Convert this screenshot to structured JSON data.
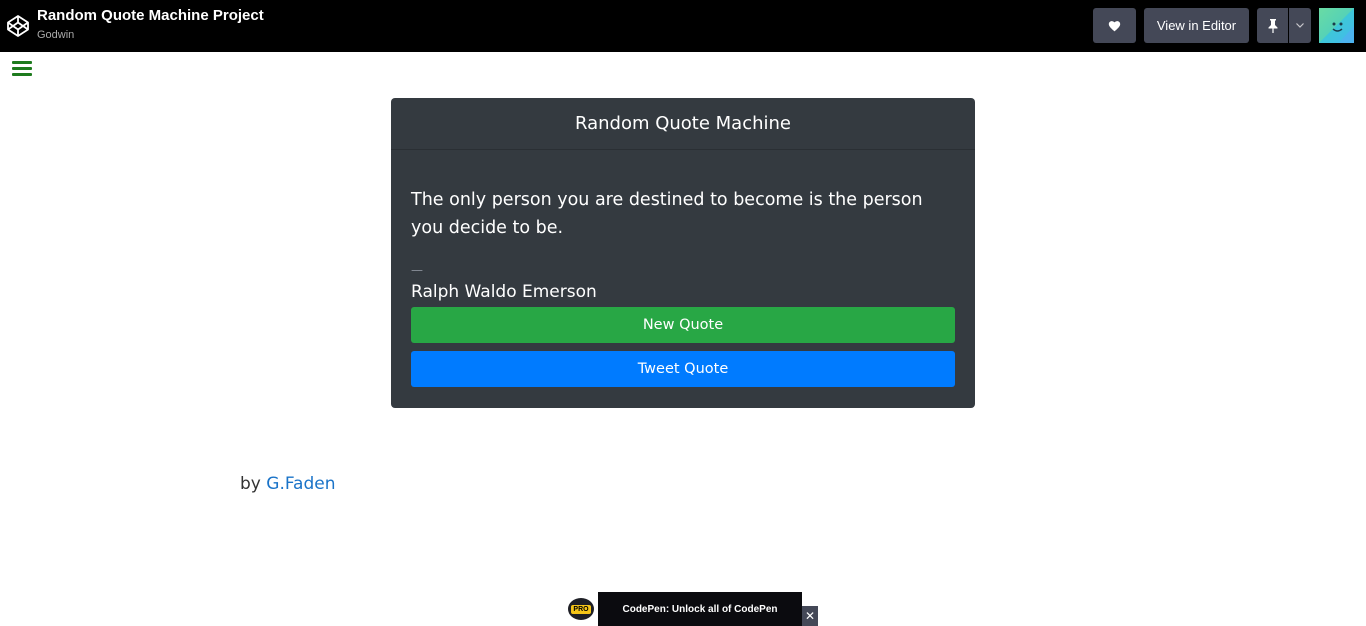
{
  "header": {
    "title": "Random Quote Machine Project",
    "author": "Godwin",
    "view_in_editor_label": "View in Editor"
  },
  "card": {
    "title": "Random Quote Machine",
    "quote": "The only person you are destined to become is the person you decide to be.",
    "dash": "—",
    "author": "Ralph Waldo Emerson",
    "new_quote_label": "New Quote",
    "tweet_quote_label": "Tweet Quote"
  },
  "byline": {
    "prefix": "by ",
    "link": "G.Faden"
  },
  "promo": {
    "badge": "PRO",
    "text": "CodePen: Unlock all of CodePen",
    "close": "✕"
  },
  "colors": {
    "new_quote": "#28a745",
    "tweet_quote": "#007bff",
    "card_bg": "#343a40"
  },
  "icons": [
    "codepen-logo-icon",
    "heart-icon",
    "pin-icon",
    "chevron-down-icon",
    "hamburger-menu-icon"
  ]
}
